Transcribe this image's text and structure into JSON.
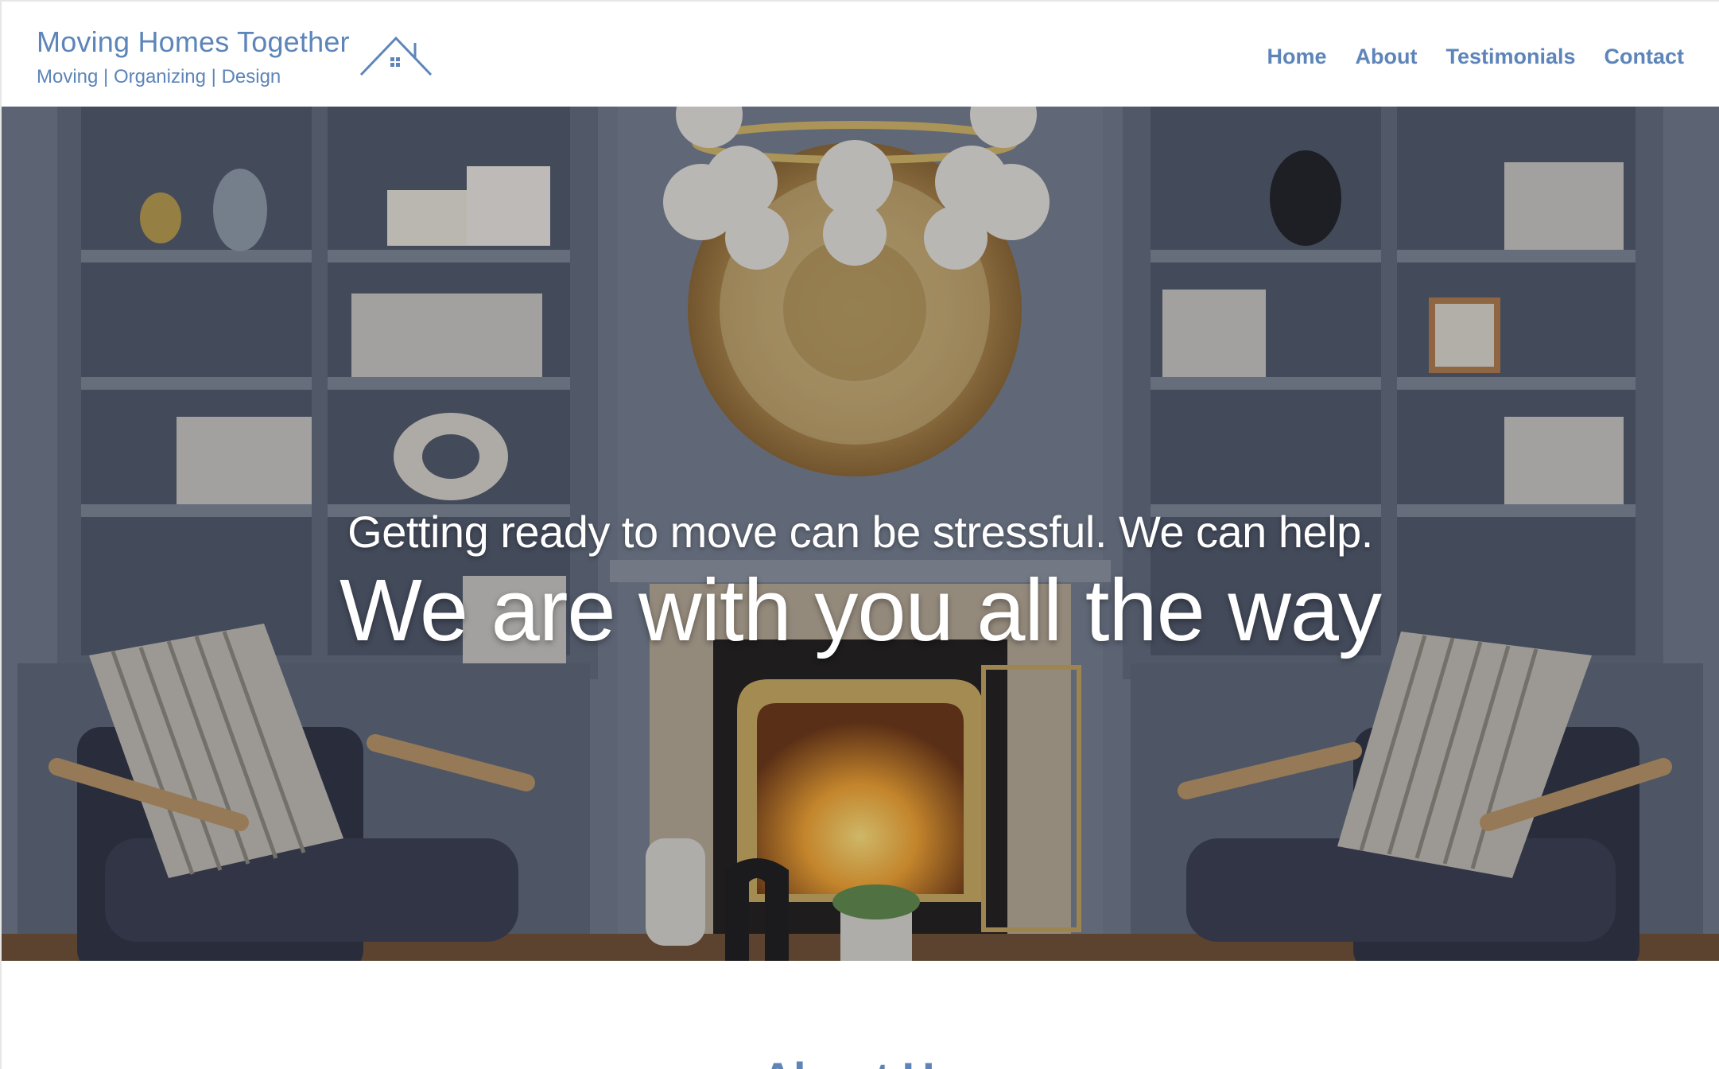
{
  "brand": {
    "title": "Moving Homes Together",
    "tagline": "Moving | Organizing | Design",
    "logo_icon": "house-icon",
    "color": "#5d85b9"
  },
  "nav": {
    "items": [
      {
        "label": "Home"
      },
      {
        "label": "About"
      },
      {
        "label": "Testimonials"
      },
      {
        "label": "Contact"
      }
    ]
  },
  "hero": {
    "subtitle": "Getting ready to move can be stressful. We can help.",
    "title": "We are with you all the way",
    "background": "living room with fireplace, built-in shelves and armchairs"
  },
  "about": {
    "heading": "About Us"
  }
}
